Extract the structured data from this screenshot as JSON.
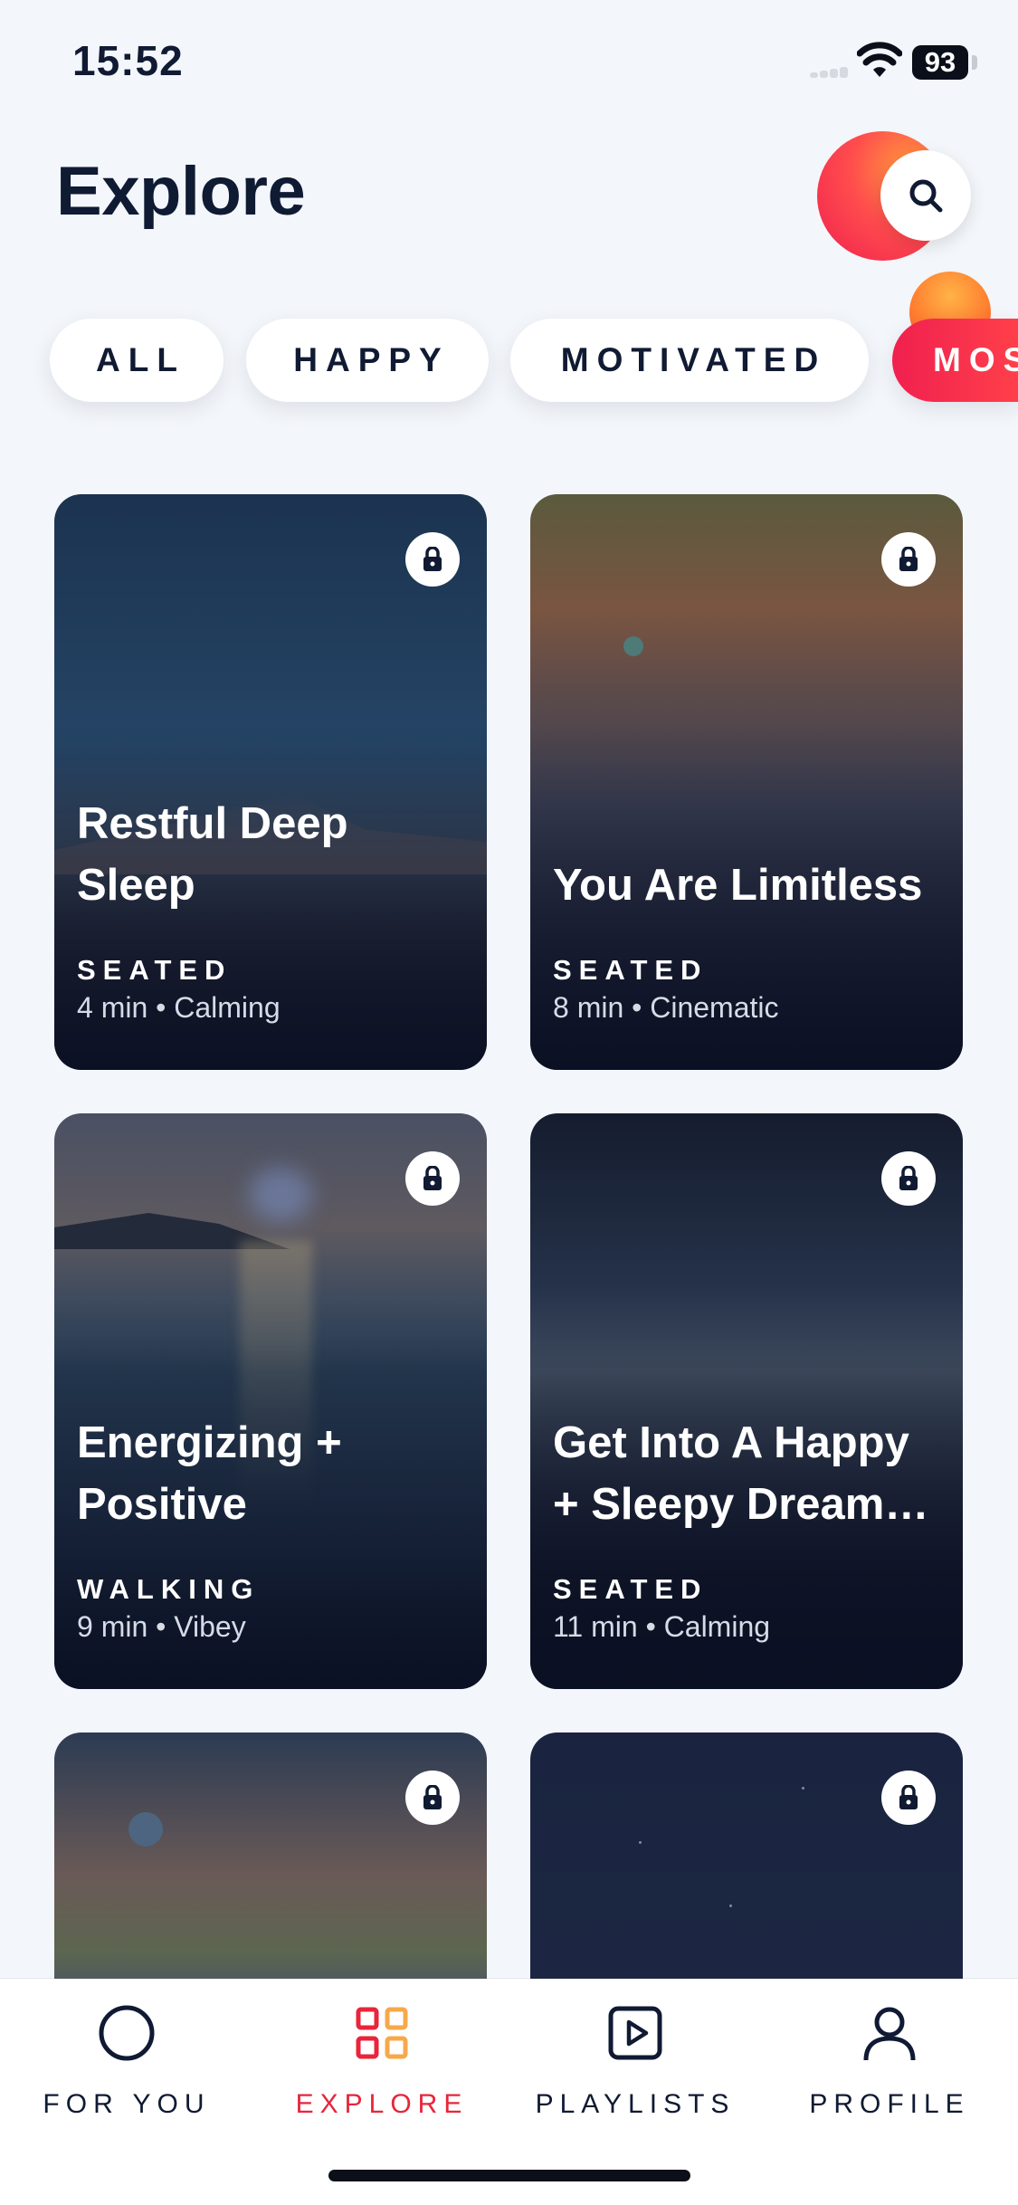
{
  "status_bar": {
    "time": "15:52",
    "battery": "93"
  },
  "header": {
    "title": "Explore"
  },
  "filters": [
    {
      "label": "ALL",
      "active": false
    },
    {
      "label": "HAPPY",
      "active": false
    },
    {
      "label": "MOTIVATED",
      "active": false
    },
    {
      "label": "MOS",
      "active": true
    }
  ],
  "cards": [
    {
      "title": "Restful Deep Sleep",
      "posture": "SEATED",
      "meta": "4 min • Calming",
      "locked": true
    },
    {
      "title": "You Are Limitless",
      "posture": "SEATED",
      "meta": "8 min • Cinematic",
      "locked": true
    },
    {
      "title": "Energizing + Positive",
      "posture": "WALKING",
      "meta": "9 min • Vibey",
      "locked": true
    },
    {
      "title": "Get Into A Happy + Sleepy Dream…",
      "posture": "SEATED",
      "meta": "11 min • Calming",
      "locked": true
    },
    {
      "title": "",
      "posture": "",
      "meta": "",
      "locked": true
    },
    {
      "title": "",
      "posture": "",
      "meta": "",
      "locked": true
    }
  ],
  "tabs": [
    {
      "label": "FOR YOU",
      "icon": "circle-icon",
      "active": false
    },
    {
      "label": "EXPLORE",
      "icon": "grid-icon",
      "active": true
    },
    {
      "label": "PLAYLISTS",
      "icon": "play-square-icon",
      "active": false
    },
    {
      "label": "PROFILE",
      "icon": "person-icon",
      "active": false
    }
  ],
  "colors": {
    "accent": "#e8253b",
    "background": "#f3f6fa",
    "text": "#101a33"
  }
}
